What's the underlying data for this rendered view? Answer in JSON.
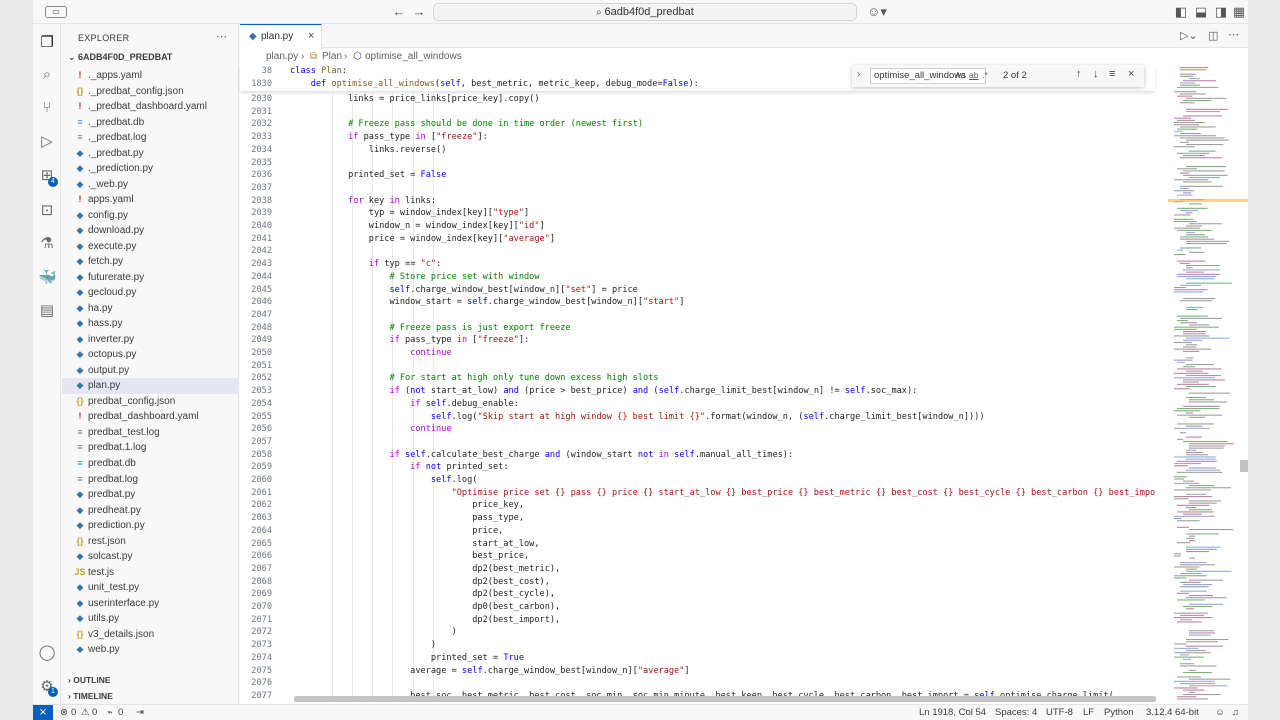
{
  "titlebar": {
    "search_text": "6adb4f0d_predbat"
  },
  "sidebar": {
    "title": "EXPLORER",
    "root": "6ADB4F0D_PREDBAT",
    "files": [
      {
        "icon": "!",
        "name": "._apps.yaml",
        "color": "#cb2431"
      },
      {
        "icon": "{}",
        "name": "._predbat_config.json",
        "color": "#c5a332"
      },
      {
        "icon": "!",
        "name": "._predbat_dashboard.yaml",
        "color": "#cb2431"
      },
      {
        "icon": "≡",
        "name": "._predbat.db",
        "color": "#3b8eea"
      },
      {
        "icon": "≡",
        "name": "._predbat.log",
        "color": "#7a7a7a"
      },
      {
        "icon": "◆",
        "name": "._predbat.py",
        "color": "#3572a5"
      },
      {
        "icon": "◆",
        "name": "._prediction.py",
        "color": "#3572a5"
      },
      {
        "icon": "◆",
        "name": "._web.py",
        "color": "#3572a5"
      },
      {
        "icon": "!",
        "name": "apps.yaml",
        "color": "#cb2431"
      },
      {
        "icon": "◆",
        "name": "config.py",
        "color": "#3572a5"
      },
      {
        "icon": "◆",
        "name": "download.py",
        "color": "#3572a5"
      },
      {
        "icon": "◆",
        "name": "execute.py",
        "color": "#3572a5"
      },
      {
        "icon": "◆",
        "name": "fetch.py",
        "color": "#3572a5"
      },
      {
        "icon": "◆",
        "name": "futurerate.py",
        "color": "#3572a5"
      },
      {
        "icon": "◆",
        "name": "gecloud.py",
        "color": "#3572a5"
      },
      {
        "icon": "◆",
        "name": "ha.py",
        "color": "#3572a5"
      },
      {
        "icon": "◆",
        "name": "hass.py",
        "color": "#3572a5"
      },
      {
        "icon": "◆",
        "name": "inverter.py",
        "color": "#3572a5"
      },
      {
        "icon": "◆",
        "name": "octopus.py",
        "color": "#3572a5"
      },
      {
        "icon": "◆",
        "name": "output.py",
        "color": "#3572a5"
      },
      {
        "icon": "◆",
        "name": "plan.py",
        "color": "#3572a5",
        "selected": true
      },
      {
        "icon": "{}",
        "name": "predbat_config.json",
        "color": "#c5a332"
      },
      {
        "icon": "!",
        "name": "predbat_dashboard.yaml",
        "color": "#cb2431"
      },
      {
        "icon": "≡",
        "name": "predbat_test.log",
        "color": "#7a7a7a"
      },
      {
        "icon": "≡",
        "name": "predbat.1.log",
        "color": "#7a7a7a"
      },
      {
        "icon": "≡",
        "name": "predbat.db",
        "color": "#3b8eea"
      },
      {
        "icon": "≡",
        "name": "predbat.log",
        "color": "#7a7a7a"
      },
      {
        "icon": "◆",
        "name": "predbat.py",
        "color": "#3572a5"
      },
      {
        "icon": "◆",
        "name": "predheat.py",
        "color": "#3572a5"
      },
      {
        "icon": "◆",
        "name": "prediction.py",
        "color": "#3572a5"
      },
      {
        "icon": "{}",
        "name": "rest.json",
        "color": "#c5a332"
      },
      {
        "icon": "◆",
        "name": "solcast.py",
        "color": "#3572a5"
      },
      {
        "icon": "JS",
        "name": "test.js",
        "color": "#c5a332"
      },
      {
        "icon": "◆",
        "name": "unit_test.py",
        "color": "#3572a5"
      },
      {
        "icon": "◆",
        "name": "userinterface.py",
        "color": "#3572a5"
      },
      {
        "icon": "◆",
        "name": "utils.py",
        "color": "#3572a5"
      },
      {
        "icon": "{}",
        "name": "v3_details.json",
        "color": "#c5a332"
      },
      {
        "icon": "◆",
        "name": "web.py",
        "color": "#3572a5"
      }
    ],
    "outline": "OUTLINE",
    "timeline": "TIMELINE"
  },
  "editor": {
    "tab_label": "plan.py",
    "breadcrumbs": [
      "plan.py",
      "Plan",
      "optimise_all_windows"
    ],
    "sticky": [
      {
        "ln": "38",
        "html": "<span class='kw'>class</span> <span class='fn'>Plan</span>:",
        "indent": 0
      },
      {
        "ln": "1830",
        "html": "    <span class='kw'>def</span> <span class='fn'>optimise_all_windows</span>(<span class='self'>self</span>, best_metric, metric_keep, debug_mode=<span class='kw'>False</span>):",
        "indent": 0
      }
    ],
    "lines": [
      {
        "ln": "2030",
        "t": "            links = price_links[price_key].copy()"
      },
      {
        "ln": "2031",
        "t": ""
      },
      {
        "ln": "2032",
        "t": "            # Freeze pass should be done in time order (newest first)",
        "c": "cm"
      },
      {
        "ln": "2033",
        "t": "            if pass_type in [\"freeze\"]:"
      },
      {
        "ln": "2034",
        "t": "                links.reverse()"
      },
      {
        "ln": "2035",
        "t": ""
      },
      {
        "ln": "2036",
        "t": "            printed_set = False"
      },
      {
        "ln": "2037",
        "t": ""
      },
      {
        "ln": "2038",
        "t": "            for key in links:"
      },
      {
        "ln": "2039",
        "t": "                typ = window_index[key][\"type\"]"
      },
      {
        "ln": "2040",
        "t": "                window_n = window_index[key][\"id\"]"
      },
      {
        "ln": "2041",
        "t": "                price = window_index[key][\"average\"]"
      },
      {
        "ln": "2042",
        "t": ""
      },
      {
        "ln": "2043",
        "t": "                if typ == \"c\":"
      },
      {
        "ln": "2044",
        "t": "                    # Store price set with window",
        "c": "cm"
      },
      {
        "ln": "2045",
        "t": "                    self.charge_window_best[window_n][\"set\"] = price"
      },
      {
        "ln": "2046",
        "t": "                    window_start = self.charge_window_best[window_n][\"start\"]"
      },
      {
        "ln": "2047",
        "t": ""
      },
      {
        "ln": "2048",
        "t": "                    # Freeze pass is just export freeze",
        "c": "cm"
      },
      {
        "ln": "2049",
        "t": "                    if pass_type in [\"freeze\"]:"
      },
      {
        "ln": "2050",
        "t": "                        continue"
      },
      {
        "ln": "2051",
        "t": ""
      },
      {
        "ln": "2052",
        "t": "                    # For start at high only tune down excess high slots",
        "c": "cm"
      },
      {
        "ln": "2053",
        "t": "                    if (not start_at_low) and (price > best_price) and (self.charge_limit_best[window_n] != self.soc_max):"
      },
      {
        "ln": "2054",
        "t": "                        if self.debug_enable:"
      },
      {
        "ln": "2055",
        "t": "                            self.log(\"Skip start at high window {} best limit {}\".format(window_n, (self.charge_limit_best[window_n])))"
      },
      {
        "ln": "2056",
        "t": "                        continue"
      },
      {
        "ln": "2057",
        "t": ""
      },
      {
        "ln": "2058",
        "t": "                    if self.calculate_best_charge and (window_start not in self.manual_all_times):"
      },
      {
        "ln": "2059",
        "t": "                        if not printed_set:"
      },
      {
        "ln": "2060",
        "t": "                            self.log("
      },
      {
        "ln": "2061",
        "t": "                                \"Optimise price set {} pass {} price {} start_at_low {} best_price {} best_metric {} best_cost {} best_cycle {} best_carbon {} best_import {}\".format("
      },
      {
        "ln": "2062",
        "t": "                                    price_key,"
      },
      {
        "ln": "2063",
        "t": "                                    pass_type,"
      },
      {
        "ln": "2064",
        "t": "                                    price,"
      },
      {
        "ln": "2065",
        "t": "                                    start_at_low,"
      },
      {
        "ln": "2066",
        "t": "                                    best_price,"
      },
      {
        "ln": "2067",
        "t": "                                    dp2(best_metric),"
      },
      {
        "ln": "2068",
        "t": "                                    dp2(best_cost),"
      },
      {
        "ln": "2069",
        "t": "                                    dp2(best_cycle),"
      },
      {
        "ln": "2070",
        "t": "                                    dp0(best_carbon),"
      },
      {
        "ln": "2071",
        "t": "                                    dp2(best_import),"
      },
      {
        "ln": "2072",
        "t": "                                )"
      },
      {
        "ln": "2073",
        "t": "                            )"
      },
      {
        "ln": "2074",
        "t": "                            printed_set = True"
      },
      {
        "ln": "2075",
        "t": "                        average = self.charge_window_best[window_n][\"average\"]"
      },
      {
        "ln": "2076",
        "t": ""
      },
      {
        "ln": "2077",
        "t": "                        best_soc, best_metric, best_cost, soc_min, soc_min_minute, best_keep, best_cycle, best_carbon, best_import = self.optimise_charge_limit("
      }
    ]
  },
  "find": {
    "query": "optimise_all_windows",
    "opt_case": "Aa",
    "opt_word": "ab",
    "opt_regex": ".*",
    "count": "2 of 2"
  },
  "status": {
    "errors": "0",
    "warnings": "0",
    "ports": "0",
    "position": "Ln 1918, Col 54",
    "spaces": "Spaces: 4",
    "encoding": "UTF-8",
    "eol": "LF",
    "language": "Python",
    "interpreter": "3.12.4 64-bit"
  },
  "activity_badges": {
    "extensions": "4",
    "account": "1"
  }
}
